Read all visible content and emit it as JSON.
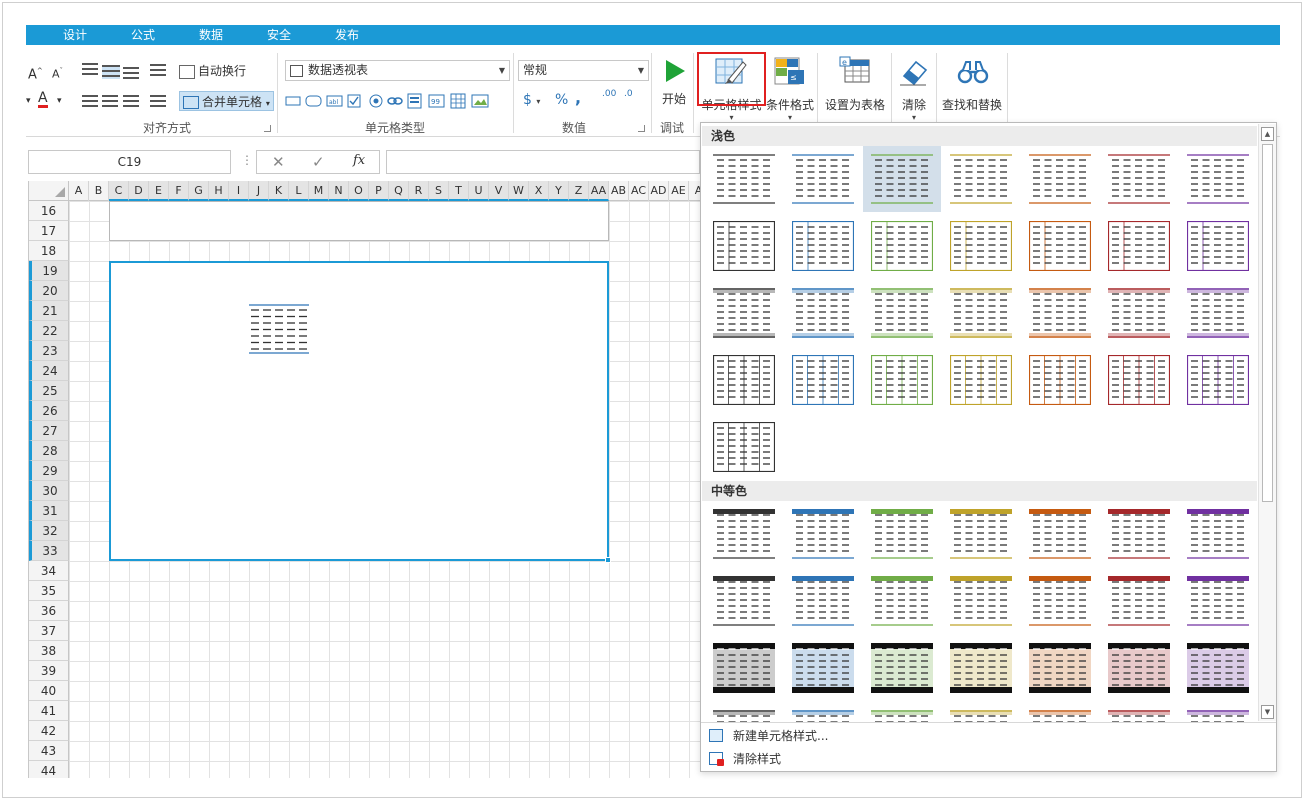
{
  "tabs": [
    "设计",
    "公式",
    "数据",
    "安全",
    "发布"
  ],
  "ribbon": {
    "align_group": "对齐方式",
    "wrap_text": "自动换行",
    "merge_cells": "合并单元格",
    "celltype_group": "单元格类型",
    "pivot_combo": "数据透视表",
    "number_group": "数值",
    "number_format": "常规",
    "debug_group": "调试",
    "start": "开始",
    "cell_style": "单元格样式",
    "conditional_format": "条件格式",
    "set_as_table": "设置为表格",
    "clear": "清除",
    "find_replace": "查找和替换",
    "font_grow": "A",
    "font_shrink": "A",
    "percent": "%",
    "comma": ",",
    "dollar": "$",
    "dec_inc": ".00",
    "dec_dec": ".0"
  },
  "formula_bar": {
    "name_box": "C19",
    "fx": "fx",
    "cancel": "✕",
    "confirm": "✓",
    "dots": "⋮"
  },
  "columns": [
    "A",
    "B",
    "C",
    "D",
    "E",
    "F",
    "G",
    "H",
    "I",
    "J",
    "K",
    "L",
    "M",
    "N",
    "O",
    "P",
    "Q",
    "R",
    "S",
    "T",
    "U",
    "V",
    "W",
    "X",
    "Y",
    "Z",
    "AA",
    "AB",
    "AC",
    "AD",
    "AE",
    "A"
  ],
  "rows": [
    "16",
    "17",
    "18",
    "19",
    "20",
    "21",
    "22",
    "23",
    "24",
    "25",
    "26",
    "27",
    "28",
    "29",
    "30",
    "31",
    "32",
    "33",
    "34",
    "35",
    "36",
    "37",
    "38",
    "39",
    "40",
    "41",
    "42",
    "43",
    "44"
  ],
  "selected_cell": "C19",
  "gallery": {
    "light_label": "浅色",
    "medium_label": "中等色",
    "new_style": "新建单元格样式...",
    "clear_style": "清除样式",
    "palette": [
      "#333333",
      "#2e75b6",
      "#70ad47",
      "#bfa32a",
      "#c55a11",
      "#a5282b",
      "#7030a0"
    ]
  },
  "colors": {
    "accent": "#1b9ad6",
    "highlight": "#e02020"
  }
}
